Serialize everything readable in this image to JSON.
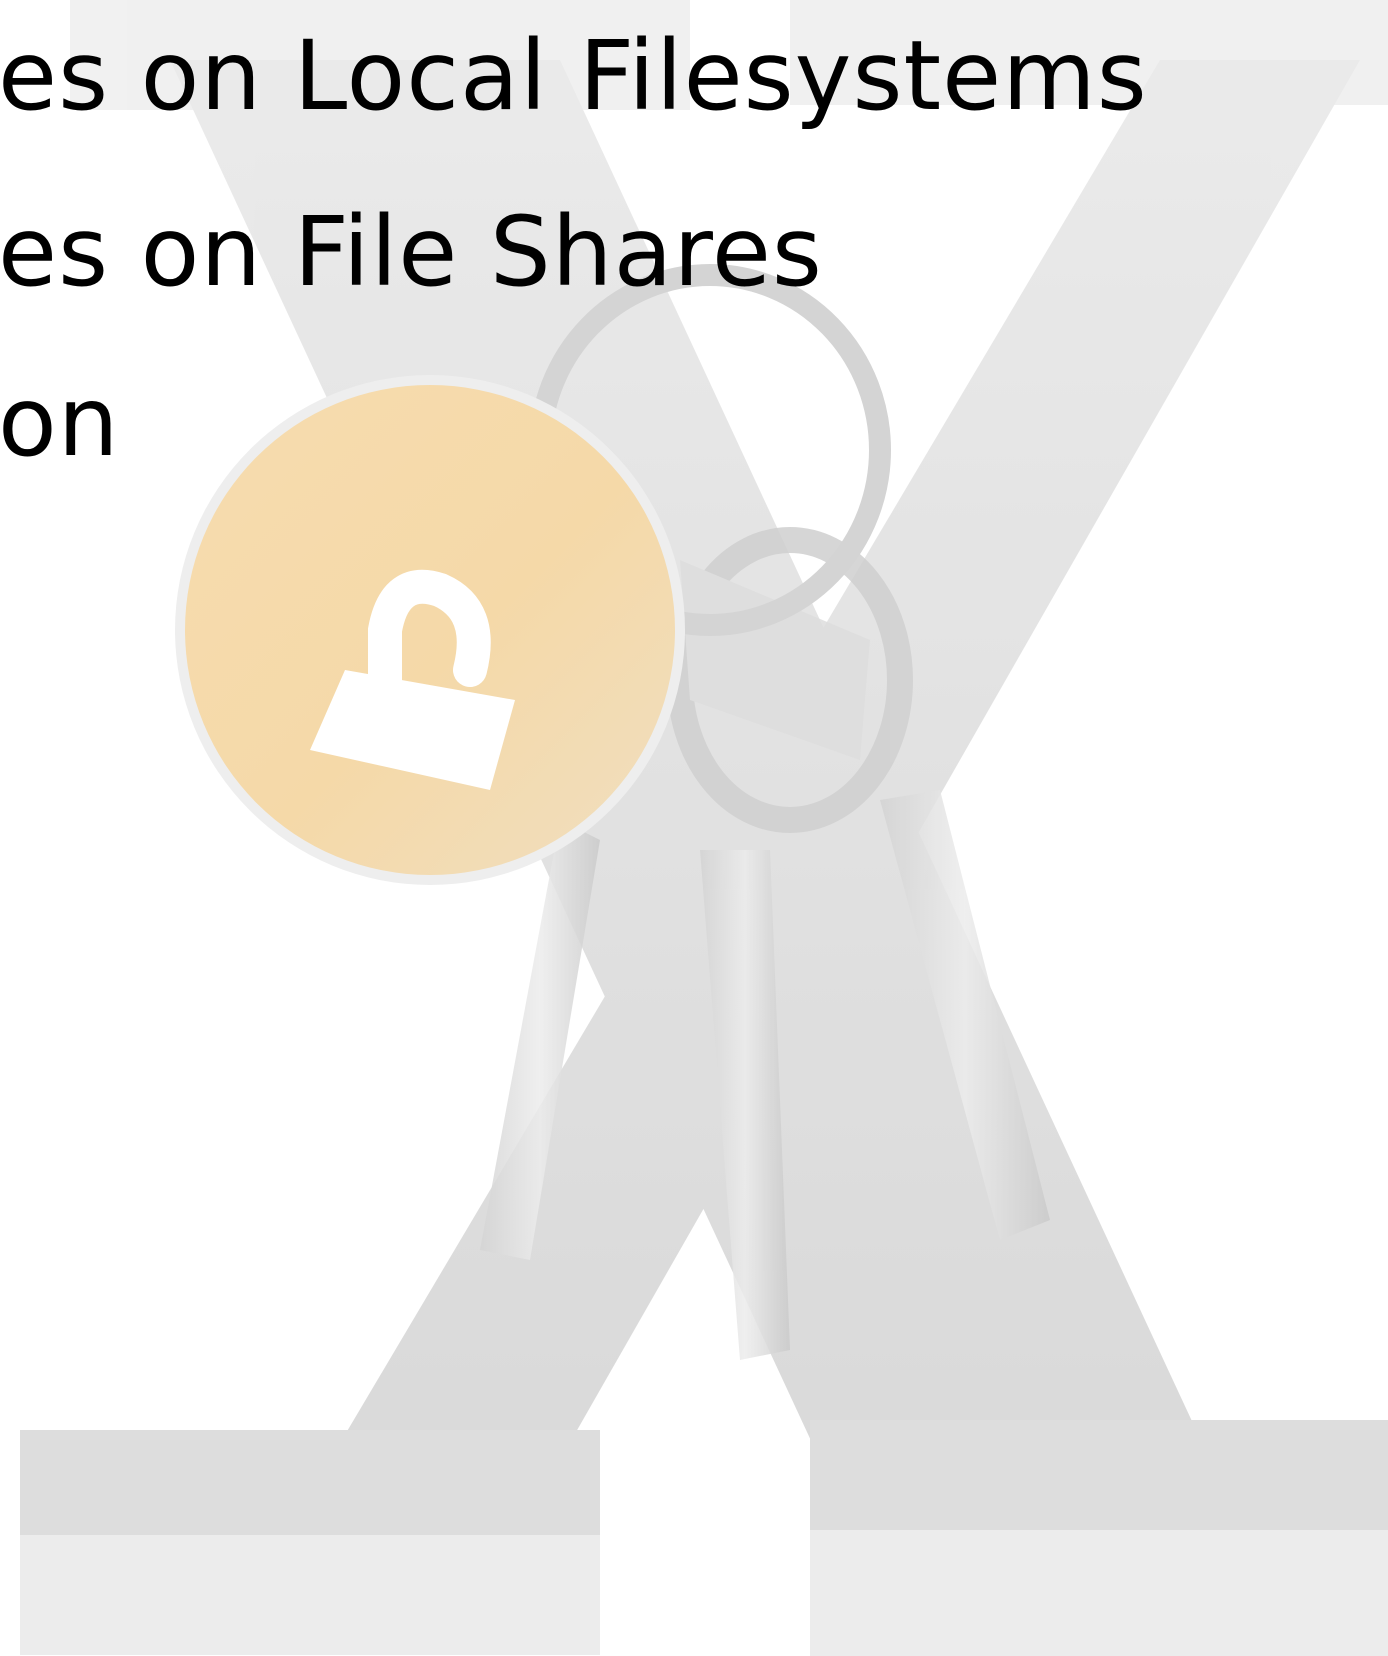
{
  "slide": {
    "lines": [
      "es on Local Filesystems",
      "es on File Shares",
      "on"
    ],
    "background": {
      "graphic": "keychain-x-watermark",
      "icons": [
        "x-logo-icon",
        "keychain-icon",
        "lock-icon",
        "key-icon"
      ],
      "colors": {
        "x_gray": "#d6d6d6",
        "tag_orange": "#f6d49a",
        "key_gray": "#cfcfcf"
      }
    }
  }
}
